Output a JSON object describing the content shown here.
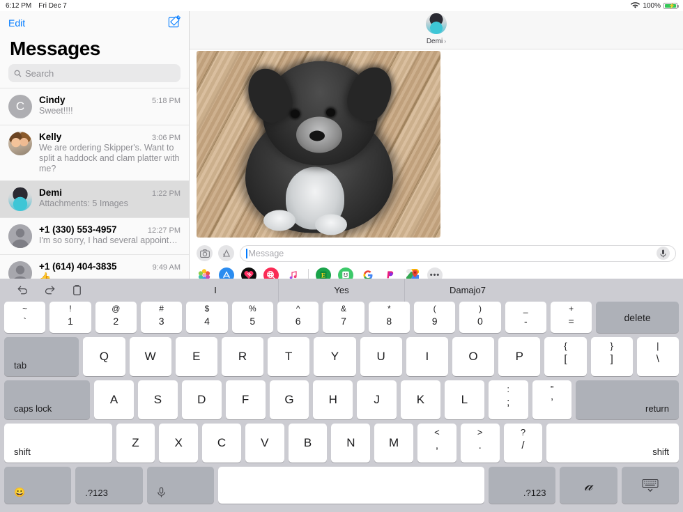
{
  "statusbar": {
    "time": "6:12 PM",
    "date": "Fri Dec 7",
    "wifi_icon": "wifi-icon",
    "battery_percent": "100%",
    "battery_icon": "battery-charging-icon"
  },
  "sidebar": {
    "edit_label": "Edit",
    "compose_icon": "compose-icon",
    "title": "Messages",
    "search": {
      "icon": "search-icon",
      "placeholder": "Search",
      "value": ""
    },
    "conversations": [
      {
        "name": "Cindy",
        "time": "5:18 PM",
        "preview": "Sweet!!!!",
        "avatar_type": "initial",
        "avatar_initial": "C",
        "selected": false,
        "two_line": false
      },
      {
        "name": "Kelly",
        "time": "3:06 PM",
        "preview": "We are ordering Skipper's.  Want to split a haddock and clam platter with me?",
        "avatar_type": "photo-kelly",
        "avatar_initial": "",
        "selected": false,
        "two_line": true
      },
      {
        "name": "Demi",
        "time": "1:22 PM",
        "preview": "Attachments: 5 Images",
        "avatar_type": "photo-demi",
        "avatar_initial": "",
        "selected": true,
        "two_line": false
      },
      {
        "name": "+1 (330) 553-4957",
        "time": "12:27 PM",
        "preview": "I'm so sorry, I had several appointment...",
        "avatar_type": "person",
        "avatar_initial": "",
        "selected": false,
        "two_line": false
      },
      {
        "name": "+1 (614) 404-3835",
        "time": "9:49 AM",
        "preview": "👍",
        "avatar_type": "person",
        "avatar_initial": "",
        "selected": false,
        "two_line": false
      }
    ]
  },
  "conversation": {
    "header": {
      "contact_name": "Demi",
      "chevron": "›",
      "avatar": "demi-avatar"
    },
    "messages": [
      {
        "type": "image",
        "description": "photo of a black and white shih tzu puppy sitting on a wooden deck",
        "from": "them"
      }
    ]
  },
  "input_bar": {
    "camera_icon": "camera-icon",
    "appstore_icon": "app-store-icon",
    "placeholder": "Message",
    "value": "",
    "mic_icon": "microphone-icon"
  },
  "app_drawer": {
    "apps": [
      {
        "name": "photos-app-icon",
        "label": "Photos"
      },
      {
        "name": "app-store-app-icon",
        "label": "App Store"
      },
      {
        "name": "digital-touch-app-icon",
        "label": "Digital Touch"
      },
      {
        "name": "images-search-app-icon",
        "label": "#images"
      },
      {
        "name": "music-app-icon",
        "label": "Music"
      },
      {
        "name": "divider",
        "label": ""
      },
      {
        "name": "etsy-app-icon",
        "label": "Etsy"
      },
      {
        "name": "bitmoji-app-icon",
        "label": "Bitmoji"
      },
      {
        "name": "google-app-icon",
        "label": "Google"
      },
      {
        "name": "paypal-app-icon",
        "label": "PayPal"
      },
      {
        "name": "google-maps-app-icon",
        "label": "Google Maps"
      },
      {
        "name": "more-apps-icon",
        "label": "More"
      }
    ]
  },
  "keyboard": {
    "toolbar": {
      "undo_icon": "undo-icon",
      "redo_icon": "redo-icon",
      "paste_icon": "paste-icon",
      "predictions": [
        "I",
        "Yes",
        "Damajo7"
      ]
    },
    "rows": [
      {
        "name": "number-row",
        "keys": [
          {
            "type": "dual",
            "top": "~",
            "bot": "`",
            "name": "key-tilde-grave"
          },
          {
            "type": "dual",
            "top": "!",
            "bot": "1",
            "name": "key-1"
          },
          {
            "type": "dual",
            "top": "@",
            "bot": "2",
            "name": "key-2"
          },
          {
            "type": "dual",
            "top": "#",
            "bot": "3",
            "name": "key-3"
          },
          {
            "type": "dual",
            "top": "$",
            "bot": "4",
            "name": "key-4"
          },
          {
            "type": "dual",
            "top": "%",
            "bot": "5",
            "name": "key-5"
          },
          {
            "type": "dual",
            "top": "^",
            "bot": "6",
            "name": "key-6"
          },
          {
            "type": "dual",
            "top": "&",
            "bot": "7",
            "name": "key-7"
          },
          {
            "type": "dual",
            "top": "*",
            "bot": "8",
            "name": "key-8"
          },
          {
            "type": "dual",
            "top": "(",
            "bot": "9",
            "name": "key-9"
          },
          {
            "type": "dual",
            "top": ")",
            "bot": "0",
            "name": "key-0"
          },
          {
            "type": "dual",
            "top": "_",
            "bot": "-",
            "name": "key-minus"
          },
          {
            "type": "dual",
            "top": "+",
            "bot": "=",
            "name": "key-equals"
          },
          {
            "type": "dark-center",
            "label": "delete",
            "name": "key-delete"
          }
        ]
      },
      {
        "name": "qwerty-row",
        "keys": [
          {
            "type": "dark-bottomleft",
            "label": "tab",
            "name": "key-tab"
          },
          {
            "type": "letter",
            "label": "Q",
            "name": "key-q"
          },
          {
            "type": "letter",
            "label": "W",
            "name": "key-w"
          },
          {
            "type": "letter",
            "label": "E",
            "name": "key-e"
          },
          {
            "type": "letter",
            "label": "R",
            "name": "key-r"
          },
          {
            "type": "letter",
            "label": "T",
            "name": "key-t"
          },
          {
            "type": "letter",
            "label": "Y",
            "name": "key-y"
          },
          {
            "type": "letter",
            "label": "U",
            "name": "key-u"
          },
          {
            "type": "letter",
            "label": "I",
            "name": "key-i"
          },
          {
            "type": "letter",
            "label": "O",
            "name": "key-o"
          },
          {
            "type": "letter",
            "label": "P",
            "name": "key-p"
          },
          {
            "type": "dual",
            "top": "{",
            "bot": "[",
            "name": "key-bracket-left"
          },
          {
            "type": "dual",
            "top": "}",
            "bot": "]",
            "name": "key-bracket-right"
          },
          {
            "type": "dual",
            "top": "|",
            "bot": "\\",
            "name": "key-backslash"
          }
        ]
      },
      {
        "name": "home-row",
        "keys": [
          {
            "type": "dark-bottomleft",
            "label": "caps lock",
            "name": "key-caps-lock"
          },
          {
            "type": "letter",
            "label": "A",
            "name": "key-a"
          },
          {
            "type": "letter",
            "label": "S",
            "name": "key-s"
          },
          {
            "type": "letter",
            "label": "D",
            "name": "key-d"
          },
          {
            "type": "letter",
            "label": "F",
            "name": "key-f"
          },
          {
            "type": "letter",
            "label": "G",
            "name": "key-g"
          },
          {
            "type": "letter",
            "label": "H",
            "name": "key-h"
          },
          {
            "type": "letter",
            "label": "J",
            "name": "key-j"
          },
          {
            "type": "letter",
            "label": "K",
            "name": "key-k"
          },
          {
            "type": "letter",
            "label": "L",
            "name": "key-l"
          },
          {
            "type": "dual",
            "top": ":",
            "bot": ";",
            "name": "key-semicolon"
          },
          {
            "type": "dual",
            "top": "”",
            "bot": "’",
            "name": "key-quote"
          },
          {
            "type": "dark-bottomright",
            "label": "return",
            "name": "key-return"
          }
        ]
      },
      {
        "name": "shift-row",
        "keys": [
          {
            "type": "light-bottomleft",
            "label": "shift",
            "name": "key-shift-left"
          },
          {
            "type": "letter",
            "label": "Z",
            "name": "key-z"
          },
          {
            "type": "letter",
            "label": "X",
            "name": "key-x"
          },
          {
            "type": "letter",
            "label": "C",
            "name": "key-c"
          },
          {
            "type": "letter",
            "label": "V",
            "name": "key-v"
          },
          {
            "type": "letter",
            "label": "B",
            "name": "key-b"
          },
          {
            "type": "letter",
            "label": "N",
            "name": "key-n"
          },
          {
            "type": "letter",
            "label": "M",
            "name": "key-m"
          },
          {
            "type": "dual",
            "top": "<",
            "bot": ",",
            "name": "key-comma"
          },
          {
            "type": "dual",
            "top": ">",
            "bot": ".",
            "name": "key-period"
          },
          {
            "type": "dual",
            "top": "?",
            "bot": "/",
            "name": "key-slash"
          },
          {
            "type": "light-bottomright",
            "label": "shift",
            "name": "key-shift-right"
          }
        ]
      },
      {
        "name": "bottom-row",
        "keys": [
          {
            "type": "dark-bottomleft-emoji",
            "label": "😀",
            "name": "key-emoji"
          },
          {
            "type": "dark-bottomleft",
            "label": ".?123",
            "name": "key-numbers-left"
          },
          {
            "type": "dark-bottomleft-icon",
            "label": "microphone-icon",
            "name": "key-dictation"
          },
          {
            "type": "space",
            "label": "",
            "name": "key-space"
          },
          {
            "type": "dark-bottomright",
            "label": ".?123",
            "name": "key-numbers-right"
          },
          {
            "type": "dark-center-glyph",
            "label": "𝒶",
            "name": "key-handwriting"
          },
          {
            "type": "dark-center-icon",
            "label": "hide-keyboard-icon",
            "name": "key-hide-keyboard"
          }
        ]
      }
    ]
  }
}
